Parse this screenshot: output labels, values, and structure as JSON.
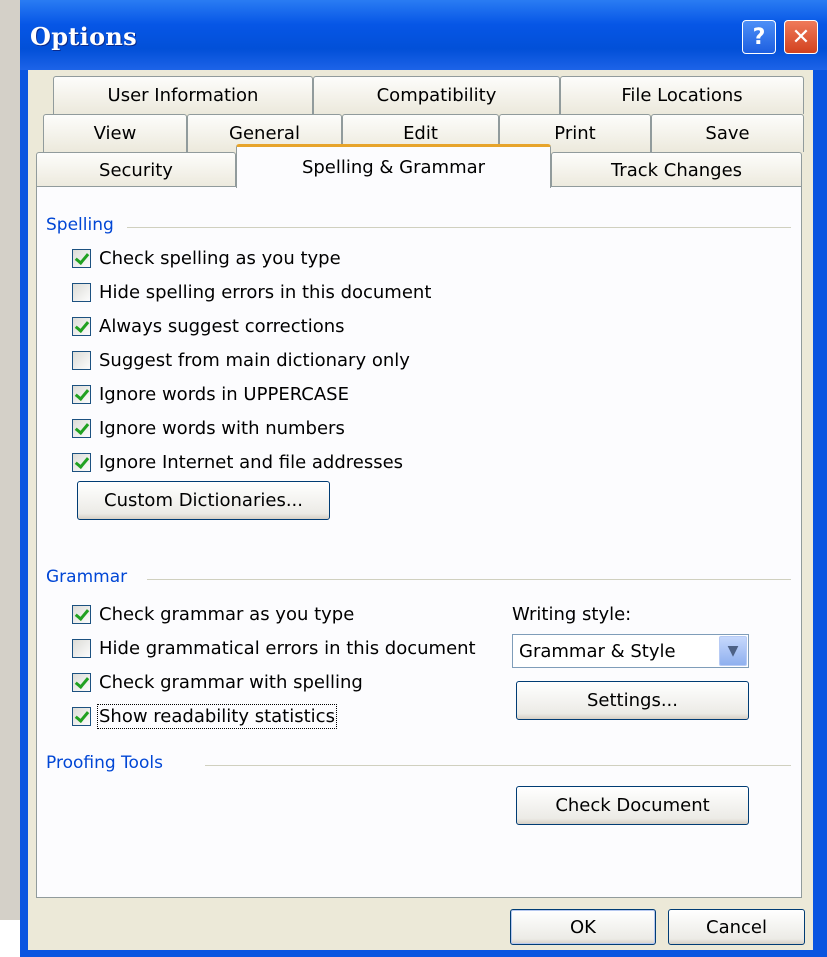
{
  "window": {
    "title": "Options"
  },
  "titlebar_buttons": {
    "help": "?",
    "close": "✕"
  },
  "tabs": {
    "row1": [
      "User Information",
      "Compatibility",
      "File Locations"
    ],
    "row2": [
      "View",
      "General",
      "Edit",
      "Print",
      "Save"
    ],
    "row3": [
      "Security",
      "Spelling & Grammar",
      "Track Changes"
    ],
    "active": "Spelling & Grammar"
  },
  "spelling": {
    "heading": "Spelling",
    "options": [
      {
        "label": "Check spelling as you type",
        "checked": true
      },
      {
        "label": "Hide spelling errors in this document",
        "checked": false
      },
      {
        "label": "Always suggest corrections",
        "checked": true
      },
      {
        "label": "Suggest from main dictionary only",
        "checked": false
      },
      {
        "label": "Ignore words in UPPERCASE",
        "checked": true
      },
      {
        "label": "Ignore words with numbers",
        "checked": true
      },
      {
        "label": "Ignore Internet and file addresses",
        "checked": true
      }
    ],
    "custom_dictionaries_button": "Custom Dictionaries..."
  },
  "grammar": {
    "heading": "Grammar",
    "options": [
      {
        "label": "Check grammar as you type",
        "checked": true
      },
      {
        "label": "Hide grammatical errors in this document",
        "checked": false
      },
      {
        "label": "Check grammar with spelling",
        "checked": true
      },
      {
        "label": "Show readability statistics",
        "checked": true
      }
    ],
    "writing_style_label": "Writing style:",
    "writing_style_value": "Grammar & Style",
    "settings_button": "Settings..."
  },
  "proofing": {
    "heading": "Proofing Tools",
    "check_document_button": "Check Document"
  },
  "footer": {
    "ok": "OK",
    "cancel": "Cancel"
  },
  "colors": {
    "titlebar": "#0250d8",
    "group_heading": "#0046d5",
    "active_tab_accent": "#e7a42b",
    "face": "#ece9d8"
  }
}
